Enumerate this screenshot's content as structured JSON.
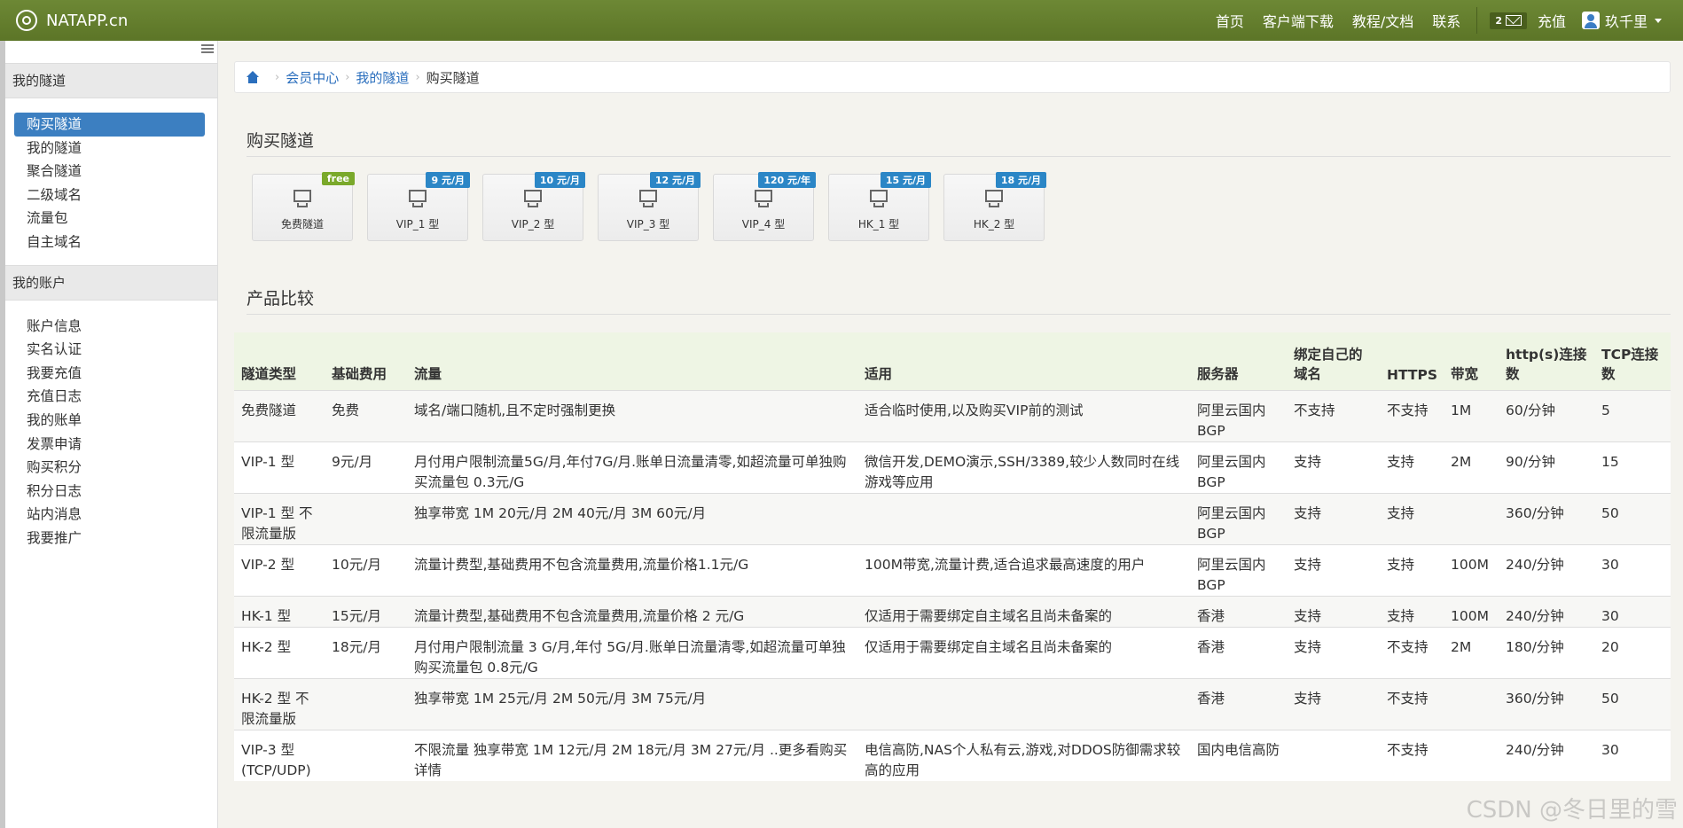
{
  "nav": {
    "brand": "NATAPP.cn",
    "links": [
      "首页",
      "客户端下载",
      "教程/文档",
      "联系"
    ],
    "message_count": "2",
    "recharge": "充值",
    "user": "玖千里"
  },
  "sidebar": {
    "groups": [
      {
        "title": "我的隧道",
        "items": [
          "购买隧道",
          "我的隧道",
          "聚合隧道",
          "二级域名",
          "流量包",
          "自主域名"
        ]
      },
      {
        "title": "我的账户",
        "items": [
          "账户信息",
          "实名认证",
          "我要充值",
          "充值日志",
          "我的账单",
          "发票申请",
          "购买积分",
          "积分日志",
          "站内消息",
          "我要推广"
        ]
      }
    ]
  },
  "breadcrumb": {
    "items": [
      "会员中心",
      "我的隧道"
    ],
    "current": "购买隧道"
  },
  "buy": {
    "title": "购买隧道",
    "tiles": [
      {
        "label": "免费隧道",
        "badge": "free"
      },
      {
        "label": "VIP_1 型",
        "badge": "9 元/月"
      },
      {
        "label": "VIP_2 型",
        "badge": "10 元/月"
      },
      {
        "label": "VIP_3 型",
        "badge": "12 元/月"
      },
      {
        "label": "VIP_4 型",
        "badge": "120 元/年"
      },
      {
        "label": "HK_1 型",
        "badge": "15 元/月"
      },
      {
        "label": "HK_2 型",
        "badge": "18 元/月"
      }
    ]
  },
  "compare": {
    "title": "产品比较",
    "headers": [
      "隧道类型",
      "基础费用",
      "流量",
      "适用",
      "服务器",
      "绑定自己的域名",
      "HTTPS",
      "带宽",
      "http(s)连接数",
      "TCP连接数"
    ],
    "rows": [
      [
        "免费隧道",
        "免费",
        "域名/端口随机,且不定时强制更换",
        "适合临时使用,以及购买VIP前的测试",
        "阿里云国内BGP",
        "不支持",
        "不支持",
        "1M",
        "60/分钟",
        "5"
      ],
      [
        "VIP-1 型",
        "9元/月",
        "月付用户限制流量5G/月,年付7G/月.账单日流量清零,如超流量可单独购买流量包 0.3元/G",
        "微信开发,DEMO演示,SSH/3389,较少人数同时在线游戏等应用",
        "阿里云国内BGP",
        "支持",
        "支持",
        "2M",
        "90/分钟",
        "15"
      ],
      [
        "VIP-1 型 不限流量版",
        "",
        "独享带宽 1M 20元/月 2M 40元/月 3M 60元/月",
        "",
        "阿里云国内BGP",
        "支持",
        "支持",
        "",
        "360/分钟",
        "50"
      ],
      [
        "VIP-2 型",
        "10元/月",
        "流量计费型,基础费用不包含流量费用,流量价格1.1元/G",
        "100M带宽,流量计费,适合追求最高速度的用户",
        "阿里云国内BGP",
        "支持",
        "支持",
        "100M",
        "240/分钟",
        "30"
      ],
      [
        "HK-1 型",
        "15元/月",
        "流量计费型,基础费用不包含流量费用,流量价格 2 元/G",
        "仅适用于需要绑定自主域名且尚未备案的",
        "香港",
        "支持",
        "支持",
        "100M",
        "240/分钟",
        "30"
      ],
      [
        "HK-2 型",
        "18元/月",
        "月付用户限制流量 3 G/月,年付 5G/月.账单日流量清零,如超流量可单独购买流量包 0.8元/G",
        "仅适用于需要绑定自主域名且尚未备案的",
        "香港",
        "支持",
        "不支持",
        "2M",
        "180/分钟",
        "20"
      ],
      [
        "HK-2 型 不限流量版",
        "",
        "独享带宽 1M 25元/月 2M 50元/月 3M 75元/月",
        "",
        "香港",
        "支持",
        "不支持",
        "",
        "360/分钟",
        "50"
      ],
      [
        "VIP-3 型 (TCP/UDP)",
        "",
        "不限流量 独享带宽 1M 12元/月 2M 18元/月 3M 27元/月 ..更多看购买详情",
        "电信高防,NAS个人私有云,游戏,对DDOS防御需求较高的应用",
        "国内电信高防",
        "",
        "不支持",
        "",
        "240/分钟",
        "30"
      ]
    ]
  },
  "watermark": "CSDN @冬日里的雪"
}
